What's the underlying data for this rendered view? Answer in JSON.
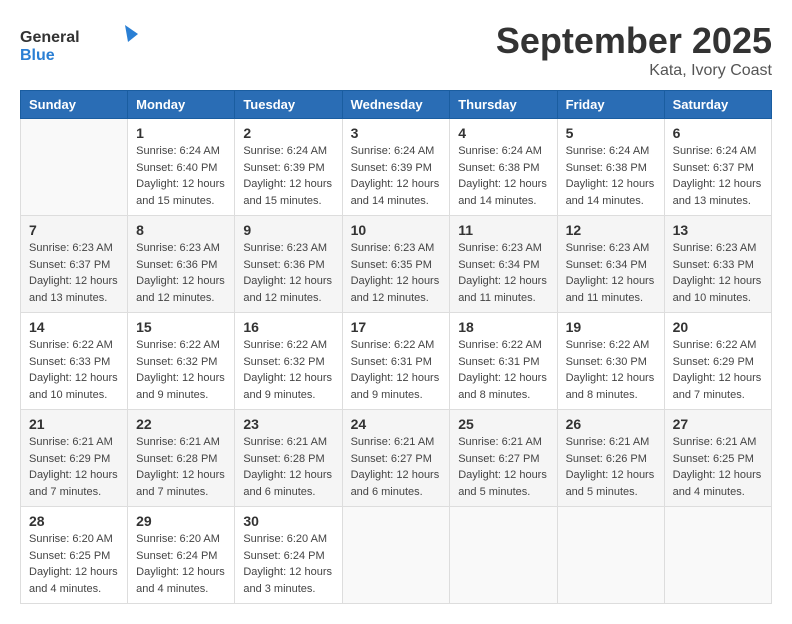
{
  "header": {
    "logo_general": "General",
    "logo_blue": "Blue",
    "month": "September 2025",
    "location": "Kata, Ivory Coast"
  },
  "days_of_week": [
    "Sunday",
    "Monday",
    "Tuesday",
    "Wednesday",
    "Thursday",
    "Friday",
    "Saturday"
  ],
  "weeks": [
    [
      {
        "day": "",
        "sunrise": "",
        "sunset": "",
        "daylight": ""
      },
      {
        "day": "1",
        "sunrise": "Sunrise: 6:24 AM",
        "sunset": "Sunset: 6:40 PM",
        "daylight": "Daylight: 12 hours and 15 minutes."
      },
      {
        "day": "2",
        "sunrise": "Sunrise: 6:24 AM",
        "sunset": "Sunset: 6:39 PM",
        "daylight": "Daylight: 12 hours and 15 minutes."
      },
      {
        "day": "3",
        "sunrise": "Sunrise: 6:24 AM",
        "sunset": "Sunset: 6:39 PM",
        "daylight": "Daylight: 12 hours and 14 minutes."
      },
      {
        "day": "4",
        "sunrise": "Sunrise: 6:24 AM",
        "sunset": "Sunset: 6:38 PM",
        "daylight": "Daylight: 12 hours and 14 minutes."
      },
      {
        "day": "5",
        "sunrise": "Sunrise: 6:24 AM",
        "sunset": "Sunset: 6:38 PM",
        "daylight": "Daylight: 12 hours and 14 minutes."
      },
      {
        "day": "6",
        "sunrise": "Sunrise: 6:24 AM",
        "sunset": "Sunset: 6:37 PM",
        "daylight": "Daylight: 12 hours and 13 minutes."
      }
    ],
    [
      {
        "day": "7",
        "sunrise": "Sunrise: 6:23 AM",
        "sunset": "Sunset: 6:37 PM",
        "daylight": "Daylight: 12 hours and 13 minutes."
      },
      {
        "day": "8",
        "sunrise": "Sunrise: 6:23 AM",
        "sunset": "Sunset: 6:36 PM",
        "daylight": "Daylight: 12 hours and 12 minutes."
      },
      {
        "day": "9",
        "sunrise": "Sunrise: 6:23 AM",
        "sunset": "Sunset: 6:36 PM",
        "daylight": "Daylight: 12 hours and 12 minutes."
      },
      {
        "day": "10",
        "sunrise": "Sunrise: 6:23 AM",
        "sunset": "Sunset: 6:35 PM",
        "daylight": "Daylight: 12 hours and 12 minutes."
      },
      {
        "day": "11",
        "sunrise": "Sunrise: 6:23 AM",
        "sunset": "Sunset: 6:34 PM",
        "daylight": "Daylight: 12 hours and 11 minutes."
      },
      {
        "day": "12",
        "sunrise": "Sunrise: 6:23 AM",
        "sunset": "Sunset: 6:34 PM",
        "daylight": "Daylight: 12 hours and 11 minutes."
      },
      {
        "day": "13",
        "sunrise": "Sunrise: 6:23 AM",
        "sunset": "Sunset: 6:33 PM",
        "daylight": "Daylight: 12 hours and 10 minutes."
      }
    ],
    [
      {
        "day": "14",
        "sunrise": "Sunrise: 6:22 AM",
        "sunset": "Sunset: 6:33 PM",
        "daylight": "Daylight: 12 hours and 10 minutes."
      },
      {
        "day": "15",
        "sunrise": "Sunrise: 6:22 AM",
        "sunset": "Sunset: 6:32 PM",
        "daylight": "Daylight: 12 hours and 9 minutes."
      },
      {
        "day": "16",
        "sunrise": "Sunrise: 6:22 AM",
        "sunset": "Sunset: 6:32 PM",
        "daylight": "Daylight: 12 hours and 9 minutes."
      },
      {
        "day": "17",
        "sunrise": "Sunrise: 6:22 AM",
        "sunset": "Sunset: 6:31 PM",
        "daylight": "Daylight: 12 hours and 9 minutes."
      },
      {
        "day": "18",
        "sunrise": "Sunrise: 6:22 AM",
        "sunset": "Sunset: 6:31 PM",
        "daylight": "Daylight: 12 hours and 8 minutes."
      },
      {
        "day": "19",
        "sunrise": "Sunrise: 6:22 AM",
        "sunset": "Sunset: 6:30 PM",
        "daylight": "Daylight: 12 hours and 8 minutes."
      },
      {
        "day": "20",
        "sunrise": "Sunrise: 6:22 AM",
        "sunset": "Sunset: 6:29 PM",
        "daylight": "Daylight: 12 hours and 7 minutes."
      }
    ],
    [
      {
        "day": "21",
        "sunrise": "Sunrise: 6:21 AM",
        "sunset": "Sunset: 6:29 PM",
        "daylight": "Daylight: 12 hours and 7 minutes."
      },
      {
        "day": "22",
        "sunrise": "Sunrise: 6:21 AM",
        "sunset": "Sunset: 6:28 PM",
        "daylight": "Daylight: 12 hours and 7 minutes."
      },
      {
        "day": "23",
        "sunrise": "Sunrise: 6:21 AM",
        "sunset": "Sunset: 6:28 PM",
        "daylight": "Daylight: 12 hours and 6 minutes."
      },
      {
        "day": "24",
        "sunrise": "Sunrise: 6:21 AM",
        "sunset": "Sunset: 6:27 PM",
        "daylight": "Daylight: 12 hours and 6 minutes."
      },
      {
        "day": "25",
        "sunrise": "Sunrise: 6:21 AM",
        "sunset": "Sunset: 6:27 PM",
        "daylight": "Daylight: 12 hours and 5 minutes."
      },
      {
        "day": "26",
        "sunrise": "Sunrise: 6:21 AM",
        "sunset": "Sunset: 6:26 PM",
        "daylight": "Daylight: 12 hours and 5 minutes."
      },
      {
        "day": "27",
        "sunrise": "Sunrise: 6:21 AM",
        "sunset": "Sunset: 6:25 PM",
        "daylight": "Daylight: 12 hours and 4 minutes."
      }
    ],
    [
      {
        "day": "28",
        "sunrise": "Sunrise: 6:20 AM",
        "sunset": "Sunset: 6:25 PM",
        "daylight": "Daylight: 12 hours and 4 minutes."
      },
      {
        "day": "29",
        "sunrise": "Sunrise: 6:20 AM",
        "sunset": "Sunset: 6:24 PM",
        "daylight": "Daylight: 12 hours and 4 minutes."
      },
      {
        "day": "30",
        "sunrise": "Sunrise: 6:20 AM",
        "sunset": "Sunset: 6:24 PM",
        "daylight": "Daylight: 12 hours and 3 minutes."
      },
      {
        "day": "",
        "sunrise": "",
        "sunset": "",
        "daylight": ""
      },
      {
        "day": "",
        "sunrise": "",
        "sunset": "",
        "daylight": ""
      },
      {
        "day": "",
        "sunrise": "",
        "sunset": "",
        "daylight": ""
      },
      {
        "day": "",
        "sunrise": "",
        "sunset": "",
        "daylight": ""
      }
    ]
  ]
}
